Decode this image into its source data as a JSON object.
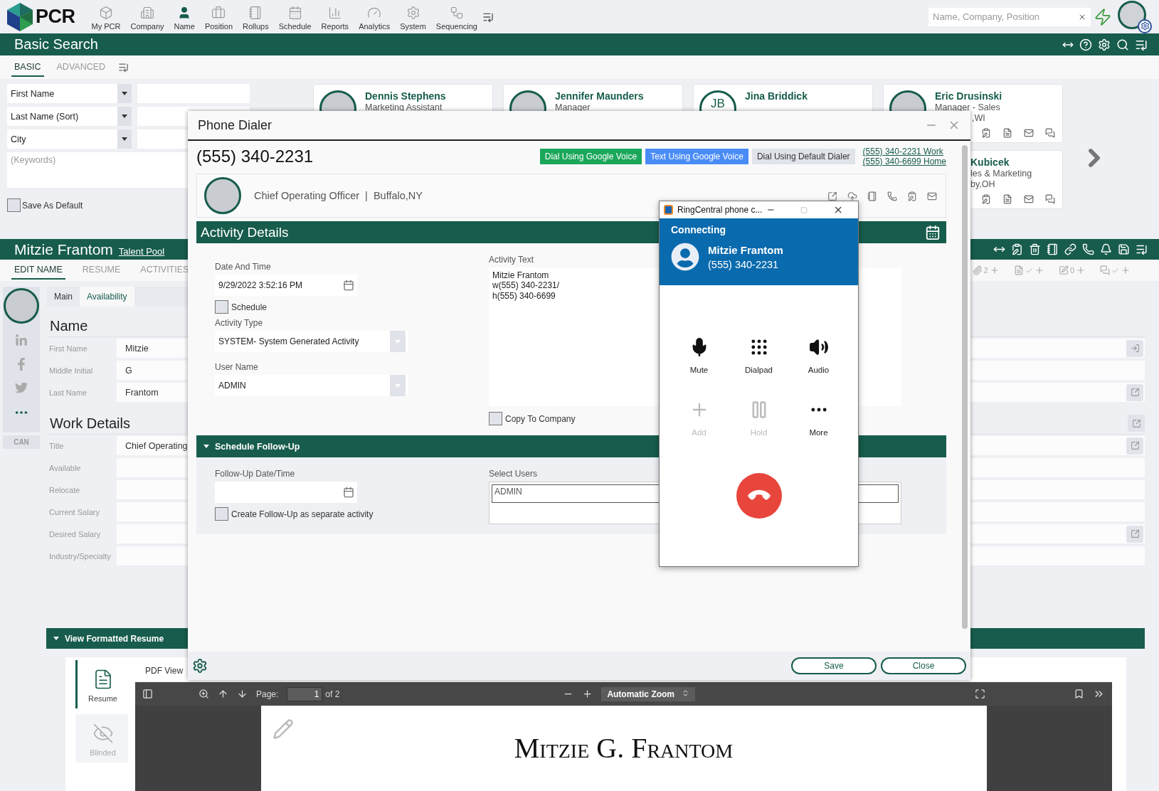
{
  "top_nav": {
    "logo": "PCR",
    "items": [
      {
        "label": "My PCR",
        "selected": false
      },
      {
        "label": "Company",
        "selected": false
      },
      {
        "label": "Name",
        "selected": true
      },
      {
        "label": "Position",
        "selected": false
      },
      {
        "label": "Rollups",
        "selected": false
      },
      {
        "label": "Schedule",
        "selected": false
      },
      {
        "label": "Reports",
        "selected": false
      },
      {
        "label": "Analytics",
        "selected": false
      },
      {
        "label": "System",
        "selected": false
      },
      {
        "label": "Sequencing",
        "selected": false
      }
    ],
    "search": {
      "placeholder": "Name, Company, Position"
    }
  },
  "search_header": {
    "title": "Basic Search"
  },
  "search_tabs": [
    {
      "label": "BASIC",
      "selected": true
    },
    {
      "label": "ADVANCED",
      "selected": false
    }
  ],
  "search_form": {
    "criteria": [
      {
        "label": "First Name"
      },
      {
        "label": "Last Name (Sort)"
      },
      {
        "label": "City"
      }
    ],
    "keywords_placeholder": "(Keywords)",
    "save_default": {
      "label": "Save As Default",
      "checked": false
    }
  },
  "result_cards": [
    {
      "kind": "photo",
      "name": "Dennis Stephens",
      "lines": [
        {
          "text": "Marketing Assistant"
        }
      ]
    },
    {
      "kind": "photo",
      "name": "Jennifer Maunders",
      "lines": [
        {
          "text": "Manager"
        }
      ]
    },
    {
      "kind": "initials",
      "initials": "JB",
      "name": "Jina Briddick"
    },
    {
      "kind": "photo",
      "name": "Eric Drusinski",
      "lines": [
        {
          "text": "Manager - Sales"
        },
        {
          "text": ",WI",
          "kind": "covered"
        }
      ]
    },
    {
      "kind": "covered",
      "name": "Kubicek",
      "lines": [
        {
          "text": "les & Marketing"
        },
        {
          "text": "by,OH"
        }
      ]
    }
  ],
  "record_header": {
    "name": "Mitzie Frantom",
    "link": "Talent Pool"
  },
  "record_tabs": [
    {
      "label": "EDIT NAME",
      "selected": true
    },
    {
      "label": "RESUME",
      "selected": false
    },
    {
      "label": "ACTIVITIES",
      "selected": false
    }
  ],
  "counters": [
    {
      "kind": "attachment",
      "count": "2"
    },
    {
      "kind": "document"
    },
    {
      "kind": "note",
      "count": "0"
    },
    {
      "kind": "chat"
    }
  ],
  "side_badge": "CAN",
  "sub_tabs": [
    {
      "label": "Main",
      "selected": true
    },
    {
      "label": "Availability",
      "selected": false
    }
  ],
  "sections": [
    {
      "title": "Name",
      "fields": [
        {
          "label": "First Name",
          "value": "Mitzie",
          "kind": "import"
        },
        {
          "label": "Middle Initial",
          "value": "G"
        },
        {
          "label": "Last Name",
          "value": "Frantom",
          "kind": "link"
        }
      ]
    },
    {
      "title": "Work Details",
      "kind": "link",
      "fields": [
        {
          "label": "Title",
          "value": "Chief Operating",
          "kind": "link"
        },
        {
          "label": "Available"
        },
        {
          "label": "Relocate"
        },
        {
          "label": "Current Salary"
        },
        {
          "label": "Desired Salary",
          "kind": "link"
        },
        {
          "label": "Industry/Specialty"
        }
      ]
    }
  ],
  "resume_panel": {
    "title": "View Formatted Resume",
    "expanded": true,
    "views": [
      {
        "label": "Resume",
        "selected": true
      },
      {
        "label": "Blinded",
        "selected": false
      }
    ],
    "viewer_tab": "PDF View",
    "pdf_toolbar": {
      "page_label": "Page:",
      "page": "1",
      "of": "of 2",
      "zoom": "Automatic Zoom"
    },
    "document_heading": "Mitzie G. Frantom"
  },
  "phone_dialer": {
    "title": "Phone Dialer",
    "number": "(555) 340-2231",
    "actions": [
      {
        "label": "Dial Using Google Voice",
        "kind": "green"
      },
      {
        "label": "Text Using Google Voice",
        "kind": "blue"
      },
      {
        "label": "Dial Using Default Dialer",
        "kind": "plain"
      }
    ],
    "phone_links": [
      "(555) 340-2231 Work",
      "(555) 340-6699 Home"
    ],
    "contact": "Chief Operating Officer  |  Buffalo,NY",
    "activity": {
      "title": "Activity Details",
      "date_label": "Date And Time",
      "date_value": "9/29/2022 3:52:16 PM",
      "schedule": {
        "label": "Schedule",
        "checked": false
      },
      "type_label": "Activity Type",
      "type_value": "SYSTEM- System Generated Activity",
      "user_label": "User Name",
      "user_value": "ADMIN",
      "text_label": "Activity Text",
      "text_value": "Mitzie Frantom\nw(555) 340-2231/\nh(555) 340-6699",
      "copy": {
        "label": "Copy To Company",
        "checked": false
      }
    },
    "follow_up": {
      "title": "Schedule Follow-Up",
      "expanded": true,
      "date_label": "Follow-Up Date/Time",
      "separate": {
        "label": "Create Follow-Up as separate activity",
        "checked": false
      },
      "users_label": "Select Users",
      "users": [
        "ADMIN"
      ]
    },
    "buttons": [
      "Save",
      "Close"
    ]
  },
  "ringcentral": {
    "title": "RingCentral phone c...",
    "status": "Connecting",
    "caller": "Mitzie Frantom",
    "number": "(555) 340-2231",
    "controls": [
      {
        "label": "Mute",
        "disabled": false
      },
      {
        "label": "Dialpad",
        "disabled": false
      },
      {
        "label": "Audio",
        "disabled": false
      },
      {
        "label": "Add",
        "disabled": true
      },
      {
        "label": "Hold",
        "disabled": true
      },
      {
        "label": "More",
        "disabled": false
      }
    ]
  }
}
